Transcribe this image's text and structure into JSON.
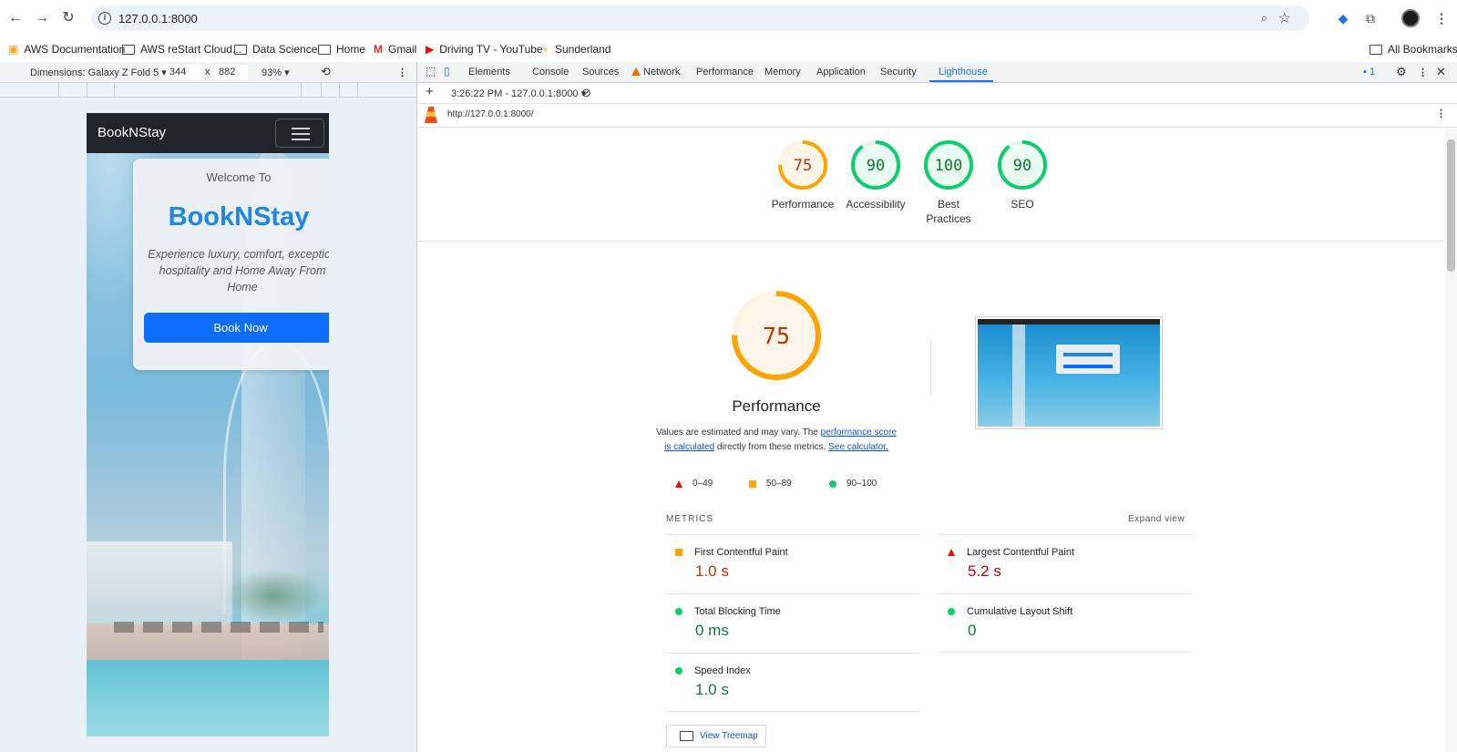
{
  "browser": {
    "url": "127.0.0.1:8000",
    "bookmarks": [
      {
        "label": "AWS Documentation",
        "icon": "aws-docs-icon"
      },
      {
        "label": "AWS reStart Cloud...",
        "icon": "folder-icon"
      },
      {
        "label": "Data Science",
        "icon": "folder-icon"
      },
      {
        "label": "Home",
        "icon": "folder-icon"
      },
      {
        "label": "Gmail",
        "icon": "gmail-icon"
      },
      {
        "label": "Driving TV - YouTube",
        "icon": "youtube-icon"
      },
      {
        "label": "Sunderland",
        "icon": "sunderland-icon"
      }
    ],
    "all_bookmarks": "All Bookmarks"
  },
  "device_toolbar": {
    "dimensions_label": "Dimensions: Galaxy Z Fold 5",
    "width": "344",
    "times": "x",
    "height": "882",
    "zoom": "93%"
  },
  "site": {
    "brand": "BookNStay",
    "welcome": "Welcome To",
    "title": "BookNStay",
    "description_line1": "Experience luxury, comfort, exception",
    "description_line2": "hospitality and Home Away From",
    "description_line3": "Home",
    "book_button": "Book Now"
  },
  "devtools": {
    "tabs": [
      "Elements",
      "Console",
      "Sources",
      "Network",
      "Performance",
      "Memory",
      "Application",
      "Security",
      "Lighthouse"
    ],
    "active_tab": "Lighthouse",
    "issues_count": "1",
    "report_selector": "3:26:22 PM - 127.0.0.1:8000",
    "report_url": "http://127.0.0.1:8000/"
  },
  "lighthouse": {
    "categories": [
      {
        "score": "75",
        "label": "Performance",
        "level": 0.75,
        "color": "#ffa400"
      },
      {
        "score": "90",
        "label": "Accessibility",
        "level": 0.9,
        "color": "#0cce6b"
      },
      {
        "score": "100",
        "label_line1": "Best",
        "label_line2": "Practices",
        "level": 1.0,
        "color": "#0cce6b"
      },
      {
        "score": "90",
        "label": "SEO",
        "level": 0.9,
        "color": "#0cce6b"
      }
    ],
    "main": {
      "score": "75",
      "title": "Performance",
      "note_prefix": "Values are estimated and may vary. The ",
      "note_link1_a": "performance score",
      "note_link1_b": "is calculated",
      "note_middle": " directly from these metrics. ",
      "note_link2": "See calculator."
    },
    "legend": [
      "0–49",
      "50–89",
      "90–100"
    ],
    "metrics_heading": "METRICS",
    "expand_view": "Expand view",
    "metrics": [
      {
        "name": "First Contentful Paint",
        "value": "1.0 s",
        "status": "average"
      },
      {
        "name": "Largest Contentful Paint",
        "value": "5.2 s",
        "status": "fail"
      },
      {
        "name": "Total Blocking Time",
        "value": "0 ms",
        "status": "pass"
      },
      {
        "name": "Cumulative Layout Shift",
        "value": "0",
        "status": "pass"
      },
      {
        "name": "Speed Index",
        "value": "1.0 s",
        "status": "pass"
      }
    ],
    "view_treemap": "View Treemap"
  }
}
